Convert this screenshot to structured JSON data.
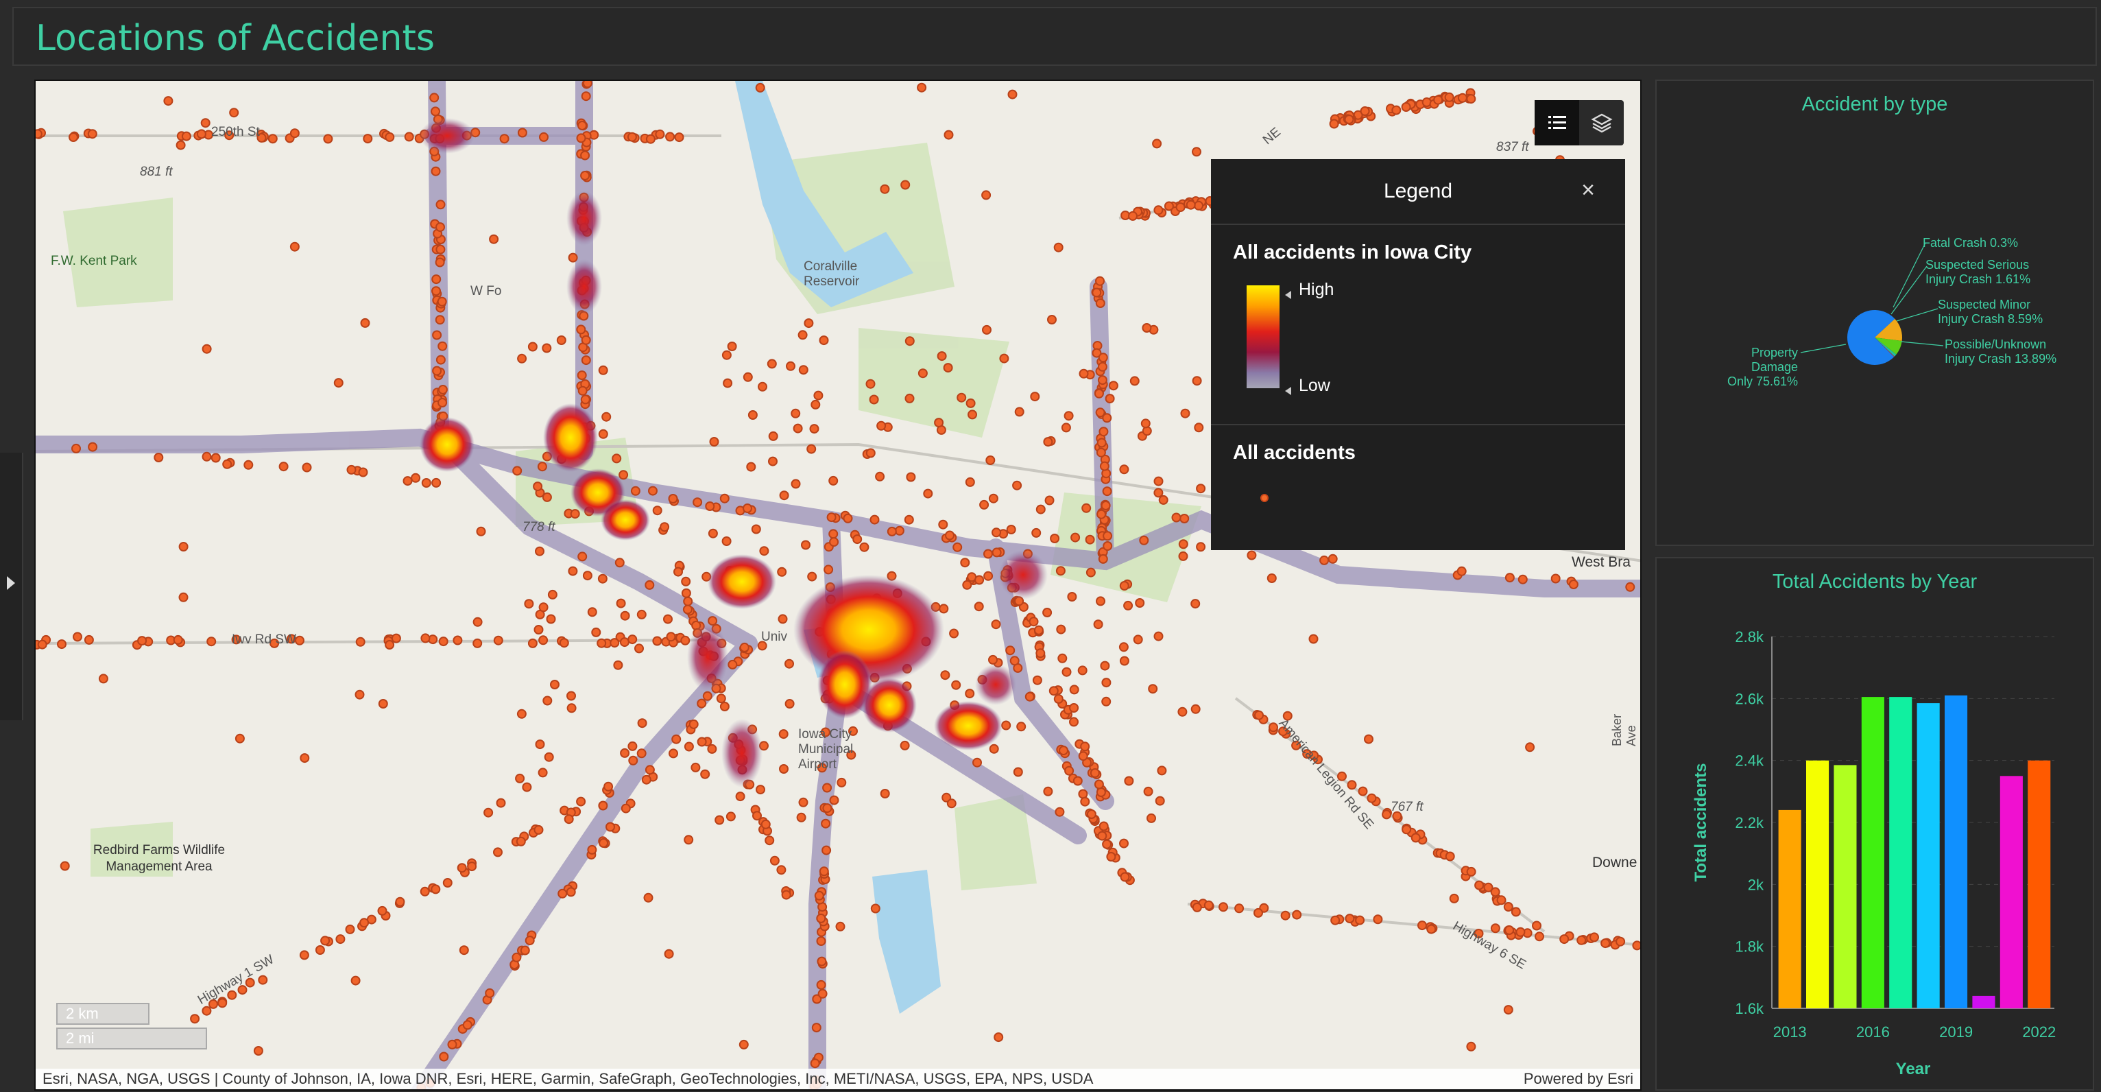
{
  "header": {
    "title": "Locations of Accidents"
  },
  "map": {
    "place_labels": [
      {
        "id": "250th",
        "text": "250th St"
      },
      {
        "id": "881ft",
        "text": "881 ft"
      },
      {
        "id": "fwkent",
        "text": "F.W. Kent Park"
      },
      {
        "id": "coralville",
        "text": "Coralville Reservoir"
      },
      {
        "id": "wfo",
        "text": "W Fo"
      },
      {
        "id": "778ft",
        "text": "778 ft"
      },
      {
        "id": "iwv",
        "text": "Iwv Rd SW"
      },
      {
        "id": "univ",
        "text": "Univ"
      },
      {
        "id": "iowacity",
        "text": "Iowa City Municipal Airport"
      },
      {
        "id": "redbird",
        "text": "Redbird Farms Wildlife Management Area"
      },
      {
        "id": "westbra",
        "text": "West Bra"
      },
      {
        "id": "767ft",
        "text": "767 ft"
      },
      {
        "id": "downe",
        "text": "Downe"
      },
      {
        "id": "bakerave",
        "text": "Baker Ave"
      },
      {
        "id": "837ft",
        "text": "837 ft"
      },
      {
        "id": "ne",
        "text": "NE"
      },
      {
        "id": "hwy1",
        "text": "Highway 1 SW"
      },
      {
        "id": "hwy6",
        "text": "Highway 6 SE"
      },
      {
        "id": "amrd",
        "text": "American Legion Rd SE"
      }
    ],
    "scalebar": {
      "km": "2 km",
      "mi": "2 mi"
    },
    "attribution": "Esri, NASA, NGA, USGS | County of Johnson, IA, Iowa DNR, Esri, HERE, Garmin, SafeGraph, GeoTechnologies, Inc, METI/NASA, USGS, EPA, NPS, USDA",
    "powered_by": "Powered by Esri",
    "tools": [
      {
        "icon": "legend-list-icon"
      },
      {
        "icon": "layers-icon"
      }
    ]
  },
  "legend": {
    "title": "Legend",
    "close": "×",
    "layer1": {
      "title": "All accidents in Iowa City",
      "high": "High",
      "low": "Low"
    },
    "layer2": {
      "title": "All accidents"
    },
    "colors": {
      "high": "#ffee00",
      "mid": "#e0201a",
      "low": "#a6a6b6",
      "point": "#f26a2a"
    }
  },
  "accident_type_panel": {
    "title": "Accident by type",
    "slices": [
      {
        "label": "Property Damage Only",
        "pct_label": "75.61%",
        "value": 75.61,
        "color": "#1a7ff0"
      },
      {
        "label": "Possible/Unknown Injury Crash",
        "pct_label": "13.89%",
        "value": 13.89,
        "color": "#f0a818"
      },
      {
        "label": "Suspected Minor Injury Crash",
        "pct_label": "8.59%",
        "value": 8.59,
        "color": "#5cd018"
      },
      {
        "label": "Suspected Serious Injury Crash",
        "pct_label": "1.61%",
        "value": 1.61,
        "color": "#20c0a0"
      },
      {
        "label": "Fatal Crash",
        "pct_label": "0.3%",
        "value": 0.3,
        "color": "#e02020"
      }
    ],
    "label_lines": {
      "fatal": "Fatal Crash 0.3%",
      "serious1": "Suspected Serious",
      "serious2": "Injury Crash 1.61%",
      "minor1": "Suspected Minor",
      "minor2": "Injury Crash 8.59%",
      "possible1": "Possible/Unknown",
      "possible2": "Injury Crash 13.89%",
      "property1": "Property Damage",
      "property2": "Only 75.61%"
    }
  },
  "chart_data": {
    "type": "bar",
    "title": "Total Accidents by Year",
    "xlabel": "Year",
    "ylabel": "Total accidents",
    "x_tick_labels": [
      "2013",
      "2016",
      "2019",
      "2022"
    ],
    "y_tick_labels": [
      "1.6k",
      "1.8k",
      "2k",
      "2.2k",
      "2.4k",
      "2.6k",
      "2.8k"
    ],
    "ylim": [
      1600,
      2800
    ],
    "grid": true,
    "categories": [
      "2013",
      "2014",
      "2015",
      "2016",
      "2017",
      "2018",
      "2019",
      "2020",
      "2021",
      "2022"
    ],
    "values": [
      2240,
      2400,
      2385,
      2605,
      2605,
      2585,
      2610,
      1640,
      2350,
      2400
    ],
    "colors": [
      "#ffa500",
      "#f5ff00",
      "#b0ff20",
      "#40f010",
      "#10f0a0",
      "#10c8ff",
      "#1090ff",
      "#d010f0",
      "#f010d0",
      "#ff5a00"
    ]
  }
}
